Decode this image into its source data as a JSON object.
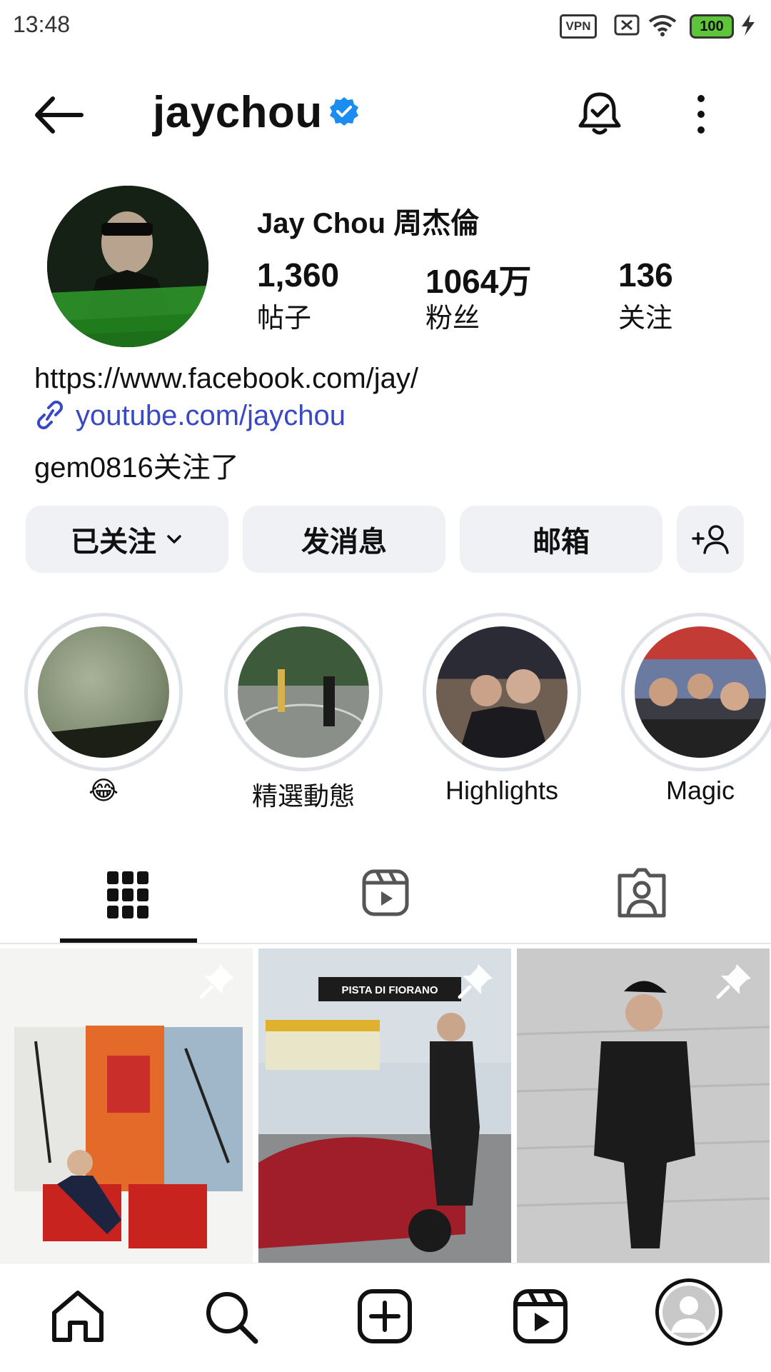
{
  "status_bar": {
    "time": "13:48",
    "vpn_label": "VPN",
    "battery": "100"
  },
  "header": {
    "username": "jaychou"
  },
  "profile": {
    "display_name": "Jay Chou 周杰倫",
    "stats": [
      {
        "value": "1,360",
        "label": "帖子"
      },
      {
        "value": "1064万",
        "label": "粉丝"
      },
      {
        "value": "136",
        "label": "关注"
      }
    ],
    "bio": "https://www.facebook.com/jay/",
    "link": "youtube.com/jaychou",
    "followed_by": "gem0816关注了"
  },
  "actions": {
    "following_label": "已关注",
    "message_label": "发消息",
    "email_label": "邮箱"
  },
  "highlights": [
    {
      "label": "😂"
    },
    {
      "label": "精選動態"
    },
    {
      "label": "Highlights"
    },
    {
      "label": "Magic"
    }
  ],
  "posts": [
    {
      "pinned": true
    },
    {
      "pinned": true,
      "sign_text": "PISTA DI FIORANO"
    },
    {
      "pinned": true
    }
  ],
  "colors": {
    "link": "#3949c4",
    "verified": "#1d8cf0",
    "button_bg": "#eff1f4"
  },
  "icons": [
    "back-arrow-icon",
    "verified-badge-icon",
    "notification-bell-icon",
    "more-vertical-icon",
    "chevron-down-icon",
    "add-person-icon",
    "grid-icon",
    "reels-icon",
    "tagged-icon",
    "pin-icon",
    "home-icon",
    "search-icon",
    "create-icon",
    "reels-nav-icon",
    "profile-icon",
    "link-icon"
  ]
}
